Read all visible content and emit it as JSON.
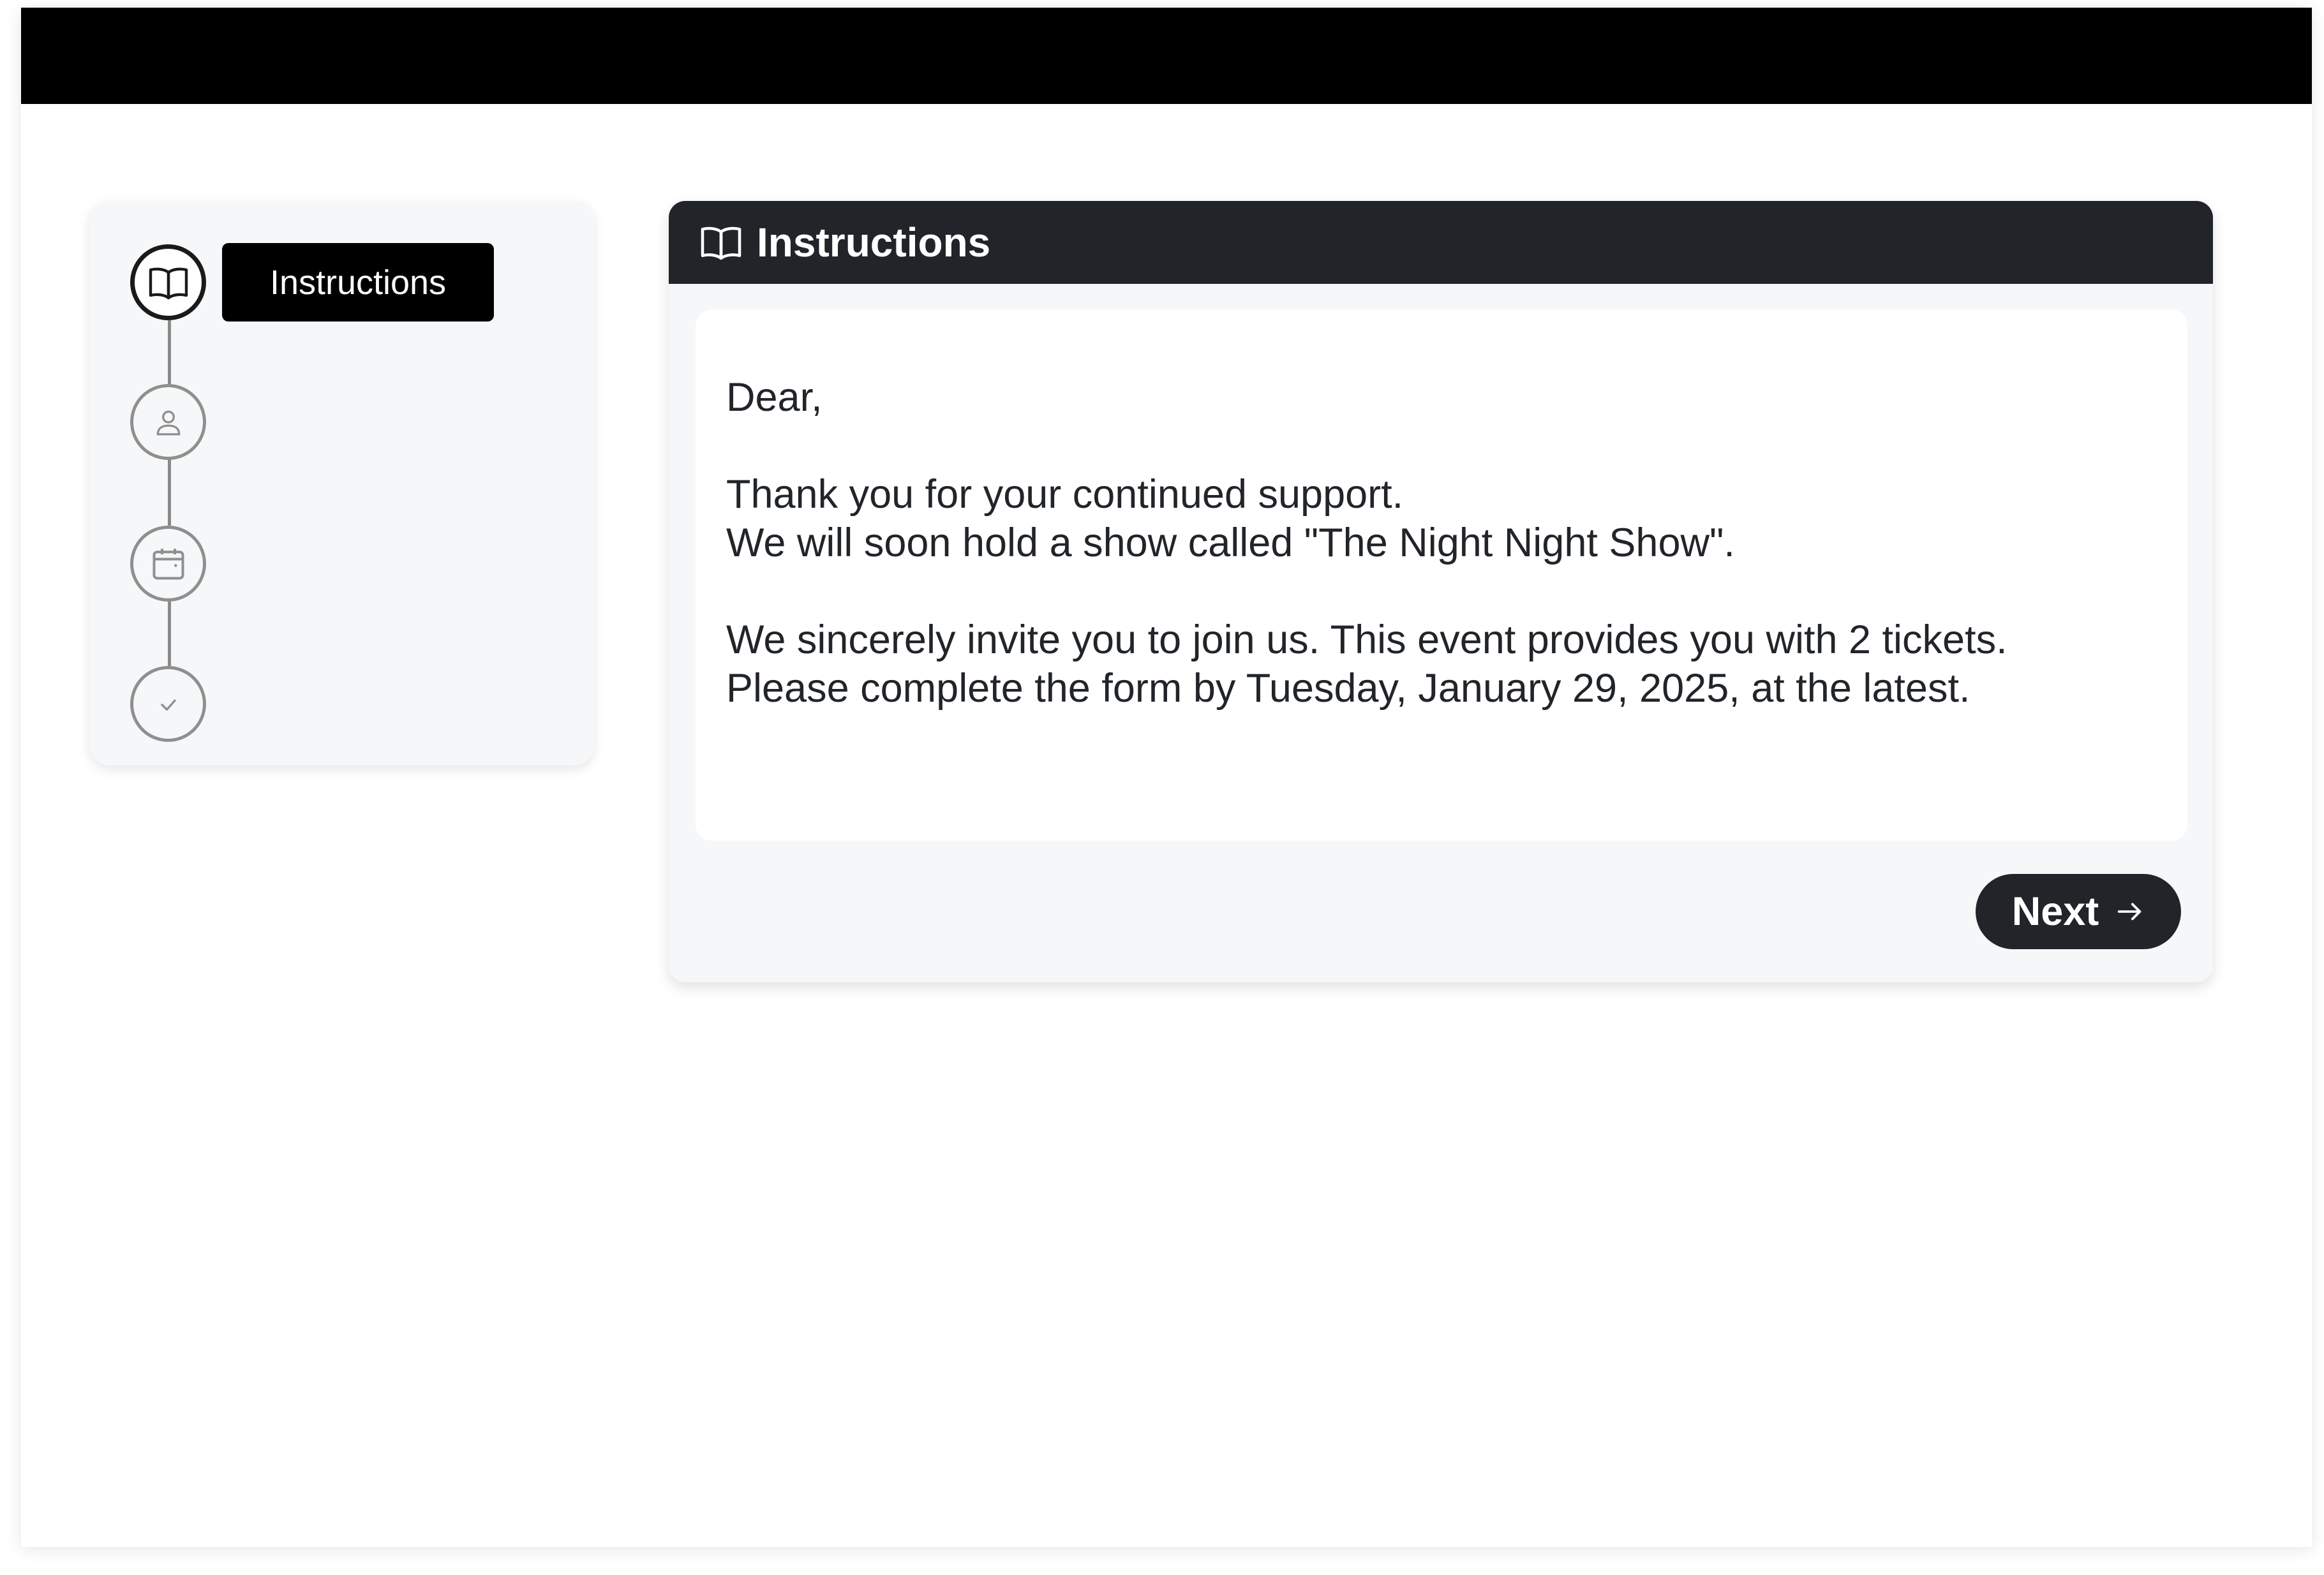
{
  "stepper": {
    "steps": [
      {
        "icon": "book-icon",
        "label": "Instructions",
        "active": true
      },
      {
        "icon": "user-icon",
        "active": false
      },
      {
        "icon": "calendar-icon",
        "active": false
      },
      {
        "icon": "check-icon",
        "active": false
      }
    ],
    "tooltip_label": "Instructions"
  },
  "card": {
    "title": "Instructions",
    "title_icon": "book-icon",
    "letter": {
      "greeting": "Dear,",
      "line1": "Thank you for your continued support.",
      "line2": "We will soon hold a show called \"The Night Night Show\".",
      "line3": "We sincerely invite you to join us. This event provides you with 2 tickets.",
      "line4": "Please complete the form by Tuesday, January 29, 2025, at the latest."
    },
    "next_label": "Next",
    "next_icon": "arrow-right-icon"
  },
  "colors": {
    "header_bg": "#212529",
    "top_bar": "#000000",
    "panel_bg": "#f6f7f9"
  }
}
